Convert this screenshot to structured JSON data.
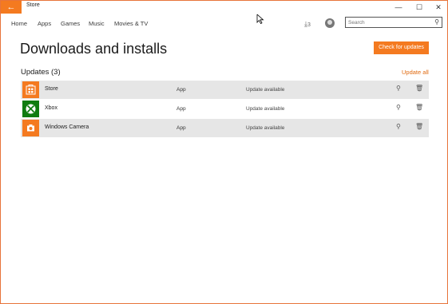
{
  "window": {
    "title": "Store",
    "back_glyph": "←",
    "minimize_glyph": "—",
    "maximize_glyph": "☐",
    "close_glyph": "✕"
  },
  "nav": {
    "items": [
      "Home",
      "Apps",
      "Games",
      "Music",
      "Movies & TV"
    ]
  },
  "downloads_indicator": {
    "count": "3",
    "icon": "download-arrow-icon"
  },
  "search": {
    "placeholder": "Search",
    "value": ""
  },
  "page": {
    "title": "Downloads and installs",
    "check_button": "Check for updates",
    "section_title": "Updates (3)",
    "update_all": "Update all"
  },
  "updates": [
    {
      "name": "Store",
      "type": "App",
      "status": "Update available",
      "tile_color": "#f47a20",
      "icon": "store-bag-icon"
    },
    {
      "name": "Xbox",
      "type": "App",
      "status": "Update available",
      "tile_color": "#107c10",
      "icon": "xbox-logo-icon"
    },
    {
      "name": "Windows Camera",
      "type": "App",
      "status": "Update available",
      "tile_color": "#f47a20",
      "icon": "camera-icon"
    }
  ],
  "colors": {
    "accent": "#f47a20",
    "link": "#e06a10",
    "row_alt": "#e6e6e6",
    "xbox_green": "#107c10"
  }
}
